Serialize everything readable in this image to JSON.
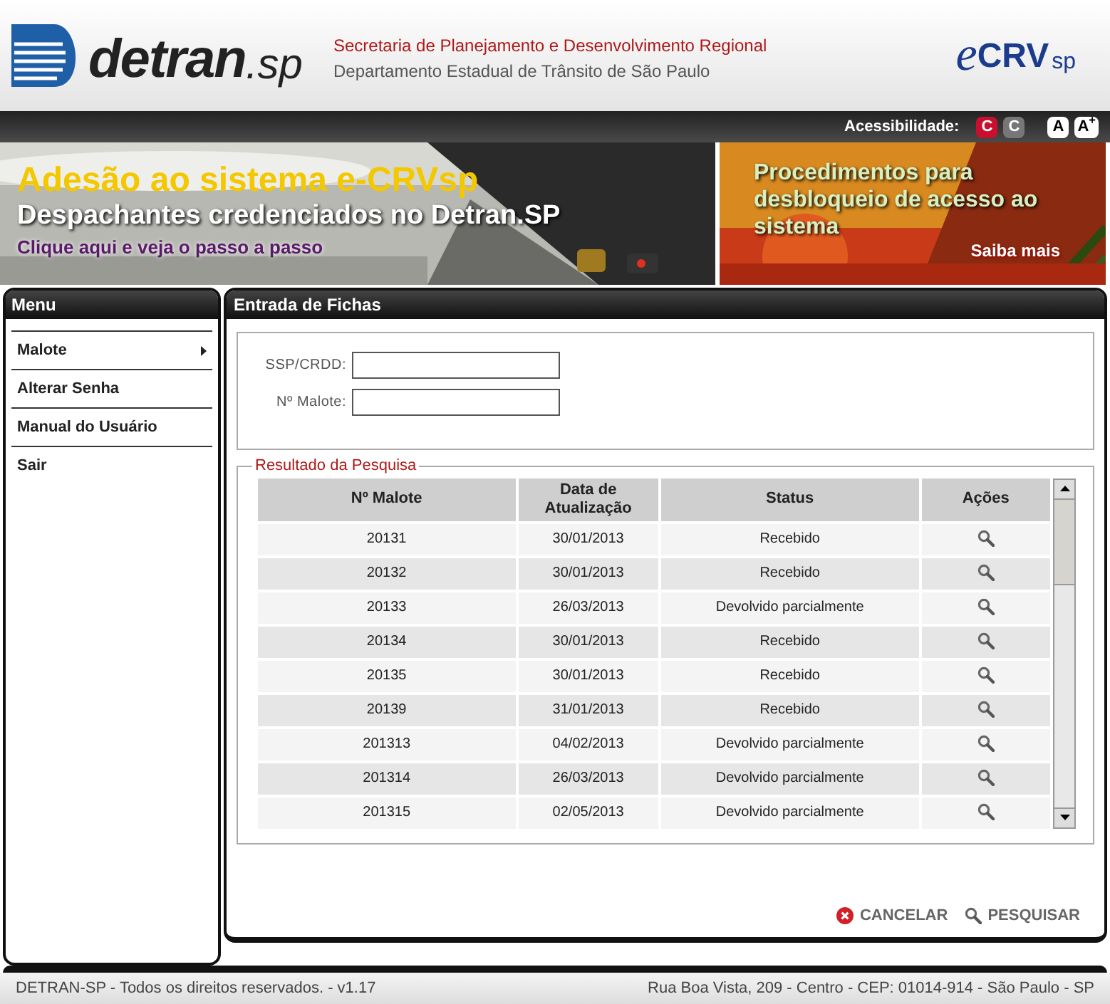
{
  "header": {
    "logo": {
      "main": "detran",
      "suffix": ".sp"
    },
    "secretaria": "Secretaria de Planejamento e Desenvolvimento Regional",
    "departamento": "Departamento Estadual de Trânsito de São Paulo",
    "ecrv_logo": {
      "prefix": "e",
      "main": "CRV",
      "suffix": "sp"
    }
  },
  "accessibility": {
    "label": "Acessibilidade:",
    "buttons": [
      {
        "text": "C",
        "kind": "contrast-red"
      },
      {
        "text": "C",
        "kind": "contrast-grey"
      },
      {
        "text": "A",
        "kind": "font"
      },
      {
        "text": "A$^{+}$",
        "kind": "font"
      }
    ]
  },
  "banners": [
    {
      "title": "Adesão ao sistema e-CRVsp",
      "subtitle": "Despachantes credenciados no Detran.SP",
      "link": "Clique aqui e veja o passo a passo"
    },
    {
      "title": "Procedimentos para desbloqueio de acesso ao sistema",
      "link": "Saiba mais"
    }
  ],
  "sidebar": {
    "title": "Menu",
    "items": [
      {
        "label": "Malote",
        "has_submenu": true
      },
      {
        "label": "Alterar Senha",
        "has_submenu": false
      },
      {
        "label": "Manual do Usuário",
        "has_submenu": false
      },
      {
        "label": "Sair",
        "has_submenu": false
      }
    ]
  },
  "content": {
    "title": "Entrada de Fichas",
    "fields": [
      {
        "label": "SSP/CRDD:"
      },
      {
        "label": "Nº Malote:"
      }
    ],
    "results": {
      "legend": "Resultado da Pesquisa",
      "columns": [
        "Nº Malote",
        "Data de Atualização",
        "Status",
        "Ações"
      ],
      "rows": [
        {
          "malote": "20131",
          "data": "30/01/2013",
          "status": "Recebido"
        },
        {
          "malote": "20132",
          "data": "30/01/2013",
          "status": "Recebido"
        },
        {
          "malote": "20133",
          "data": "26/03/2013",
          "status": "Devolvido parcialmente"
        },
        {
          "malote": "20134",
          "data": "30/01/2013",
          "status": "Recebido"
        },
        {
          "malote": "20135",
          "data": "30/01/2013",
          "status": "Recebido"
        },
        {
          "malote": "20139",
          "data": "31/01/2013",
          "status": "Recebido"
        },
        {
          "malote": "201313",
          "data": "04/02/2013",
          "status": "Devolvido parcialmente"
        },
        {
          "malote": "201314",
          "data": "26/03/2013",
          "status": "Devolvido parcialmente"
        },
        {
          "malote": "201315",
          "data": "02/05/2013",
          "status": "Devolvido parcialmente"
        }
      ]
    },
    "actions": [
      {
        "label": "CANCELAR",
        "kind": "cancel"
      },
      {
        "label": "PESQUISAR",
        "kind": "search"
      }
    ]
  },
  "footer": {
    "left": "DETRAN-SP - Todos os direitos reservados. - v1.17",
    "right": "Rua Boa Vista, 209 - Centro - CEP: 01014-914 - São Paulo - SP"
  }
}
